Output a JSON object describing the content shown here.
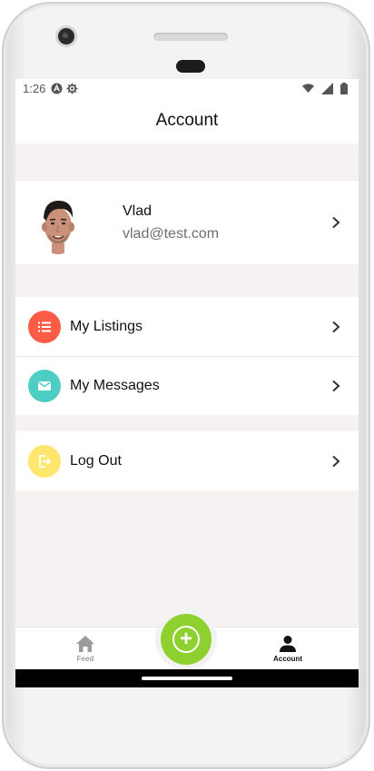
{
  "statusbar": {
    "time": "1:26"
  },
  "header": {
    "title": "Account"
  },
  "profile": {
    "name": "Vlad",
    "email": "vlad@test.com"
  },
  "menu": [
    {
      "label": "My Listings",
      "icon": "list-icon",
      "color": "#fc5c45"
    },
    {
      "label": "My Messages",
      "icon": "mail-icon",
      "color": "#4ecdc4"
    }
  ],
  "logout": {
    "label": "Log Out",
    "icon": "logout-icon",
    "color": "#ffe66d"
  },
  "tabbar": {
    "feed_label": "Feed",
    "account_label": "Account",
    "fab_icon": "plus-icon",
    "fab_color": "#8ed12e"
  }
}
